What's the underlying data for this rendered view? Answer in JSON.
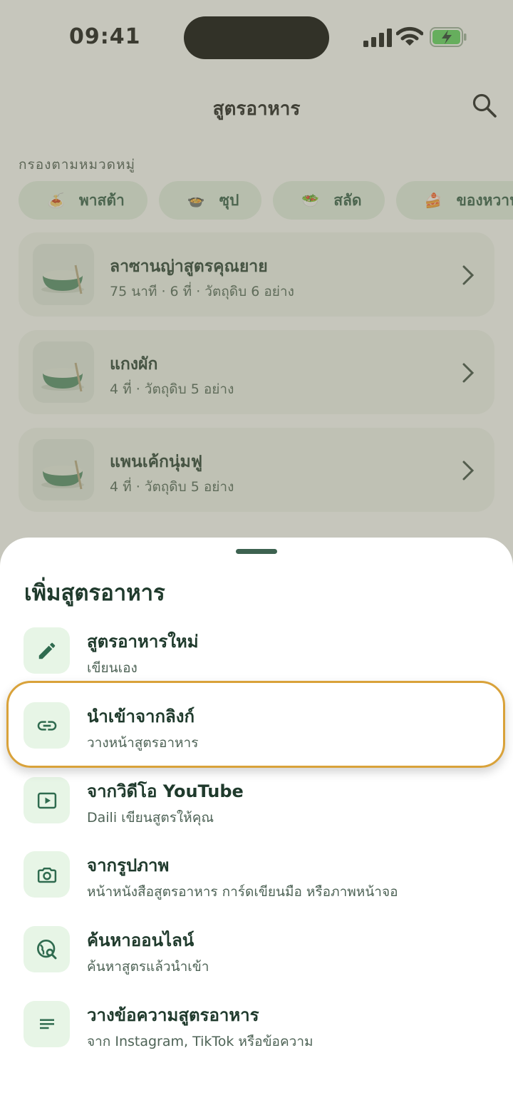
{
  "status_bar": {
    "time": "09:41"
  },
  "header": {
    "title": "สูตรอาหาร"
  },
  "filter": {
    "label": "กรองตามหมวดหมู่",
    "chips": [
      {
        "emoji": "🍝",
        "label": "พาสต้า"
      },
      {
        "emoji": "🍲",
        "label": "ซุป"
      },
      {
        "emoji": "🥗",
        "label": "สลัด"
      },
      {
        "emoji": "🍰",
        "label": "ของหวาน"
      }
    ]
  },
  "recipes": [
    {
      "title": "ลาซานญ่าสูตรคุณยาย",
      "meta": "75 นาที · 6 ที่ · วัตถุดิบ 6 อย่าง"
    },
    {
      "title": "แกงผัก",
      "meta": "4 ที่ · วัตถุดิบ 5 อย่าง"
    },
    {
      "title": "แพนเค้กนุ่มฟู",
      "meta": "4 ที่ · วัตถุดิบ 5 อย่าง"
    }
  ],
  "sheet": {
    "title": "เพิ่มสูตรอาหาร",
    "options": [
      {
        "icon": "pencil-icon",
        "title": "สูตรอาหารใหม่",
        "subtitle": "เขียนเอง"
      },
      {
        "icon": "link-icon",
        "title": "นำเข้าจากลิงก์",
        "subtitle": "วางหน้าสูตรอาหาร"
      },
      {
        "icon": "video-play-icon",
        "title": "จากวิดีโอ YouTube",
        "subtitle": "Daili เขียนสูตรให้คุณ"
      },
      {
        "icon": "camera-icon",
        "title": "จากรูปภาพ",
        "subtitle": "หน้าหนังสือสูตรอาหาร การ์ดเขียนมือ หรือภาพหน้าจอ"
      },
      {
        "icon": "globe-search-icon",
        "title": "ค้นหาออนไลน์",
        "subtitle": "ค้นหาสูตรแล้วนำเข้า"
      },
      {
        "icon": "text-lines-icon",
        "title": "วางข้อความสูตรอาหาร",
        "subtitle": "จาก Instagram, TikTok หรือข้อความ"
      }
    ]
  },
  "colors": {
    "accent": "#2f6b4f",
    "icon_bg": "#e7f5e6",
    "highlight": "#d9a23a",
    "battery_fill": "#5ad65c"
  }
}
